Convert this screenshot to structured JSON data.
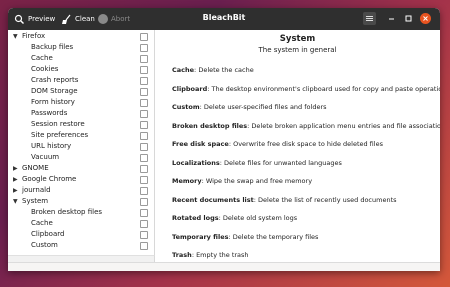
{
  "header": {
    "title": "BleachBit",
    "preview_label": "Preview",
    "clean_label": "Clean",
    "abort_label": "Abort",
    "icons": [
      "preview-icon",
      "clean-broom-icon",
      "abort-icon",
      "hamburger-menu-icon",
      "minimize-icon",
      "maximize-icon",
      "close-icon"
    ],
    "colors": {
      "header_bg": "#2f2f2f",
      "close_bg": "#e95420"
    }
  },
  "tree": [
    {
      "label": "Firefox",
      "level": 0,
      "expanded": true
    },
    {
      "label": "Backup files",
      "level": 1
    },
    {
      "label": "Cache",
      "level": 1
    },
    {
      "label": "Cookies",
      "level": 1
    },
    {
      "label": "Crash reports",
      "level": 1
    },
    {
      "label": "DOM Storage",
      "level": 1
    },
    {
      "label": "Form history",
      "level": 1
    },
    {
      "label": "Passwords",
      "level": 1
    },
    {
      "label": "Session restore",
      "level": 1
    },
    {
      "label": "Site preferences",
      "level": 1
    },
    {
      "label": "URL history",
      "level": 1
    },
    {
      "label": "Vacuum",
      "level": 1
    },
    {
      "label": "GNOME",
      "level": 0,
      "expanded": false
    },
    {
      "label": "Google Chrome",
      "level": 0,
      "expanded": false
    },
    {
      "label": "journald",
      "level": 0,
      "expanded": false
    },
    {
      "label": "System",
      "level": 0,
      "expanded": true
    },
    {
      "label": "Broken desktop files",
      "level": 1
    },
    {
      "label": "Cache",
      "level": 1
    },
    {
      "label": "Clipboard",
      "level": 1
    },
    {
      "label": "Custom",
      "level": 1
    }
  ],
  "detail": {
    "title": "System",
    "subtitle": "The system in general",
    "options": [
      {
        "name": "Cache",
        "desc": "Delete the cache"
      },
      {
        "name": "Clipboard",
        "desc": "The desktop environment's clipboard used for copy and paste operations"
      },
      {
        "name": "Custom",
        "desc": "Delete user-specified files and folders"
      },
      {
        "name": "Broken desktop files",
        "desc": "Delete broken application menu entries and file associations"
      },
      {
        "name": "Free disk space",
        "desc": "Overwrite free disk space to hide deleted files"
      },
      {
        "name": "Localizations",
        "desc": "Delete files for unwanted languages"
      },
      {
        "name": "Memory",
        "desc": "Wipe the swap and free memory"
      },
      {
        "name": "Recent documents list",
        "desc": "Delete the list of recently used documents"
      },
      {
        "name": "Rotated logs",
        "desc": "Delete old system logs"
      },
      {
        "name": "Temporary files",
        "desc": "Delete the temporary files"
      },
      {
        "name": "Trash",
        "desc": "Empty the trash"
      }
    ]
  }
}
